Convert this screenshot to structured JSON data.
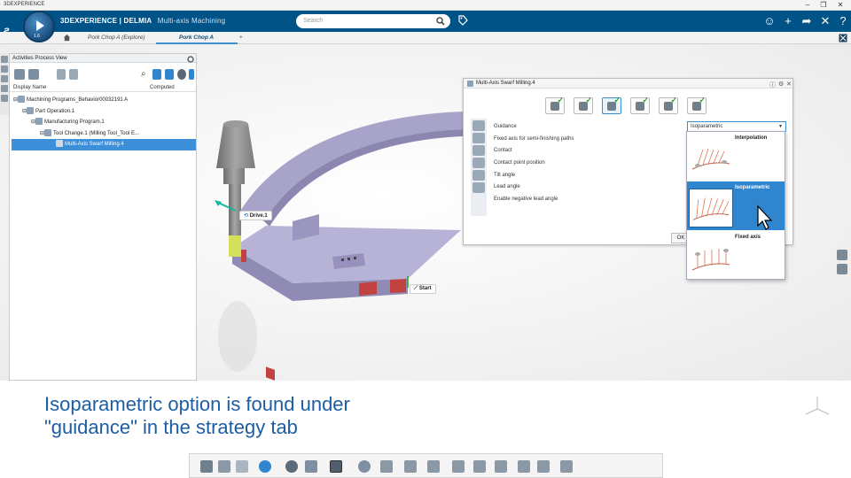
{
  "window": {
    "title": "3DEXPERIENCE",
    "controls": [
      "–",
      "❐",
      "✕"
    ]
  },
  "topbar": {
    "brand_bold": "3DEXPERIENCE | DELMIA",
    "app_name": "Multi-axis Machining",
    "search_placeholder": "Search",
    "compass_version": "1.6"
  },
  "tabs": [
    {
      "label": "Pork Chop A (Explore)",
      "active": false
    },
    {
      "label": "Pork Chop A",
      "active": true
    },
    {
      "label": "+",
      "active": false
    }
  ],
  "tree_panel": {
    "title": "Activities Process View",
    "columns": [
      "Display Name",
      "Computed"
    ],
    "rows": [
      {
        "label": "Machining Programs_Behavior00032191 A",
        "depth": 0,
        "selected": false
      },
      {
        "label": "Part Operation.1",
        "depth": 1,
        "selected": false
      },
      {
        "label": "Manufacturing Program.1",
        "depth": 2,
        "selected": false
      },
      {
        "label": "Tool Change.1 (Milling Tool_Tool E...",
        "depth": 3,
        "selected": false
      },
      {
        "label": "Multi-Axis Swarf Milling.4",
        "depth": 4,
        "selected": true
      }
    ]
  },
  "viewport": {
    "labels": {
      "drive": "Drive.1",
      "start": "Start"
    },
    "colors": {
      "part": "#a8a4c9",
      "part_dark": "#8b87b1",
      "red_faces": "#c0433f",
      "tool": "#8d8d8d",
      "holder_yellow": "#d4e05a"
    }
  },
  "dialog": {
    "title": "Multi-Axis Swarf Milling.4",
    "strategy_tabs": [
      "geometry",
      "tool",
      "strategy",
      "macros",
      "feeds",
      "speeds"
    ],
    "params": [
      "Guidance",
      "Fixed axis for semi-finishing paths",
      "Contact",
      "Contact point position",
      "Tilt angle",
      "Lead angle",
      "Enable negative lead angle"
    ],
    "guidance_value": "Isoparametric",
    "ok_label": "OK",
    "dropdown_options": [
      {
        "label": "Interpolation",
        "selected": false
      },
      {
        "label": "Isoparametric",
        "selected": true
      },
      {
        "label": "Fixed axis",
        "selected": false
      }
    ]
  },
  "caption": {
    "line1": "Isoparametric option is found  under",
    "line2": "\"guidance\" in the strategy tab"
  },
  "colors": {
    "brand_blue": "#005386",
    "selection_blue": "#3c8fd8",
    "caption_blue": "#1d5da3",
    "check_green": "#2aa02a"
  }
}
